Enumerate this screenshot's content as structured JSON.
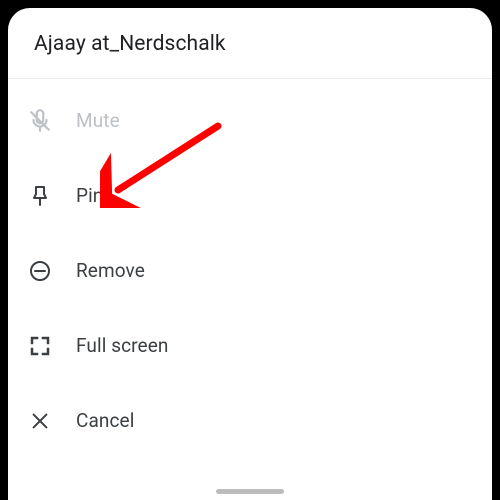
{
  "header": {
    "title": "Ajaay at_Nerdschalk"
  },
  "menu": {
    "items": [
      {
        "label": "Mute",
        "icon": "mic-off-icon",
        "disabled": true
      },
      {
        "label": "Pin",
        "icon": "pin-icon",
        "disabled": false
      },
      {
        "label": "Remove",
        "icon": "remove-circle-icon",
        "disabled": false
      },
      {
        "label": "Full screen",
        "icon": "fullscreen-icon",
        "disabled": false
      },
      {
        "label": "Cancel",
        "icon": "close-icon",
        "disabled": false
      }
    ]
  },
  "annotation": {
    "arrow_color": "#ff0000",
    "target": "pin"
  }
}
